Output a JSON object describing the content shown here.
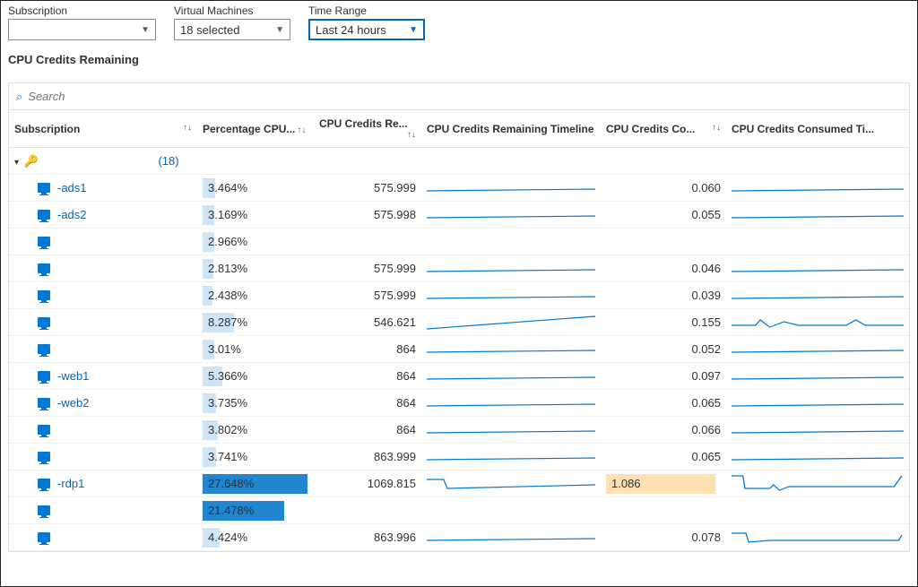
{
  "filters": {
    "subscription": {
      "label": "Subscription",
      "value": ""
    },
    "virtual_machines": {
      "label": "Virtual Machines",
      "value": "18 selected"
    },
    "time_range": {
      "label": "Time Range",
      "value": "Last 24 hours"
    }
  },
  "section_title": "CPU Credits Remaining",
  "search": {
    "placeholder": "Search"
  },
  "columns": {
    "subscription": "Subscription",
    "pcpu": "Percentage CPU...",
    "remaining": "CPU Credits Re...",
    "remaining_timeline": "CPU Credits Remaining Timeline",
    "consumed": "CPU Credits Co...",
    "consumed_timeline": "CPU Credits Consumed Ti..."
  },
  "group": {
    "count_label": "(18)"
  },
  "max_pct": 28,
  "max_con": 1.1,
  "rows": [
    {
      "name": "-ads1",
      "pct": "3.464%",
      "pct_w": 12,
      "rem": "575.999",
      "con": "0.060",
      "rem_shape": "flat",
      "con_shape": "flat"
    },
    {
      "name": "-ads2",
      "pct": "3.169%",
      "pct_w": 11,
      "rem": "575.998",
      "con": "0.055",
      "rem_shape": "flat",
      "con_shape": "flat"
    },
    {
      "name": "",
      "pct": "2.966%",
      "pct_w": 11,
      "rem": "",
      "con": "",
      "rem_shape": "none",
      "con_shape": "none"
    },
    {
      "name": "",
      "pct": "2.813%",
      "pct_w": 10,
      "rem": "575.999",
      "con": "0.046",
      "rem_shape": "flat",
      "con_shape": "flat"
    },
    {
      "name": "",
      "pct": "2.438%",
      "pct_w": 9,
      "rem": "575.999",
      "con": "0.039",
      "rem_shape": "flat",
      "con_shape": "flat"
    },
    {
      "name": "",
      "pct": "8.287%",
      "pct_w": 30,
      "rem": "546.621",
      "con": "0.155",
      "rem_shape": "rise",
      "con_shape": "wavy"
    },
    {
      "name": "",
      "pct": "3.01%",
      "pct_w": 11,
      "rem": "864",
      "con": "0.052",
      "rem_shape": "flat",
      "con_shape": "flat"
    },
    {
      "name": "-web1",
      "pct": "5.366%",
      "pct_w": 19,
      "rem": "864",
      "con": "0.097",
      "rem_shape": "flat",
      "con_shape": "flat"
    },
    {
      "name": "-web2",
      "pct": "3.735%",
      "pct_w": 13,
      "rem": "864",
      "con": "0.065",
      "rem_shape": "flat",
      "con_shape": "flat"
    },
    {
      "name": "",
      "pct": "3.802%",
      "pct_w": 14,
      "rem": "864",
      "con": "0.066",
      "rem_shape": "flat",
      "con_shape": "flat"
    },
    {
      "name": "",
      "pct": "3.741%",
      "pct_w": 13,
      "rem": "863.999",
      "con": "0.065",
      "rem_shape": "flat",
      "con_shape": "flat"
    },
    {
      "name": "-rdp1",
      "pct": "27.648%",
      "pct_w": 99,
      "rem": "1069.815",
      "con": "1.086",
      "con_hot": true,
      "strong": true,
      "rem_shape": "dip",
      "con_shape": "step"
    },
    {
      "name": "",
      "pct": "21.478%",
      "pct_w": 77,
      "rem": "",
      "con": "",
      "strong": true,
      "rem_shape": "none",
      "con_shape": "none"
    },
    {
      "name": "",
      "pct": "4.424%",
      "pct_w": 16,
      "rem": "863.996",
      "con": "0.078",
      "rem_shape": "flat",
      "con_shape": "dip2"
    }
  ]
}
